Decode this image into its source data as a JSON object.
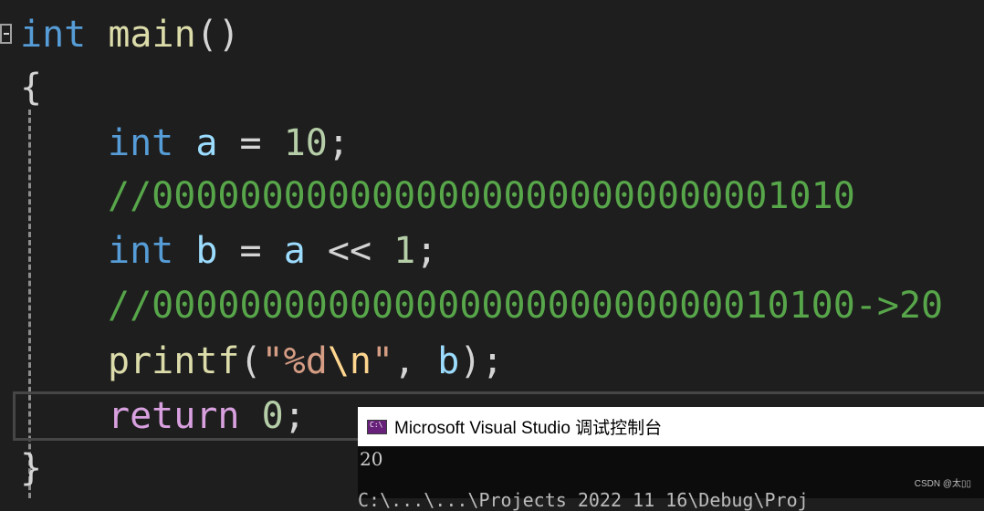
{
  "editor": {
    "lines": [
      {
        "tokens": [
          {
            "t": "int",
            "c": "kw"
          },
          {
            "t": " ",
            "c": "pun"
          },
          {
            "t": "main",
            "c": "fn"
          },
          {
            "t": "()",
            "c": "pun"
          }
        ]
      },
      {
        "tokens": [
          {
            "t": "{",
            "c": "pun"
          }
        ]
      },
      {
        "tokens": [
          {
            "t": "int",
            "c": "kw"
          },
          {
            "t": " ",
            "c": "pun"
          },
          {
            "t": "a",
            "c": "var"
          },
          {
            "t": " = ",
            "c": "pun"
          },
          {
            "t": "10",
            "c": "num"
          },
          {
            "t": ";",
            "c": "pun"
          }
        ]
      },
      {
        "tokens": [
          {
            "t": "//00000000000000000000000000001010",
            "c": "cmt"
          }
        ]
      },
      {
        "tokens": [
          {
            "t": "int",
            "c": "kw"
          },
          {
            "t": " ",
            "c": "pun"
          },
          {
            "t": "b",
            "c": "var"
          },
          {
            "t": " = ",
            "c": "pun"
          },
          {
            "t": "a",
            "c": "var"
          },
          {
            "t": " << ",
            "c": "pun"
          },
          {
            "t": "1",
            "c": "num"
          },
          {
            "t": ";",
            "c": "pun"
          }
        ]
      },
      {
        "tokens": [
          {
            "t": "//00000000000000000000000000010100->20",
            "c": "cmt"
          }
        ]
      },
      {
        "tokens": [
          {
            "t": "printf",
            "c": "fn"
          },
          {
            "t": "(",
            "c": "pun"
          },
          {
            "t": "\"%d",
            "c": "str"
          },
          {
            "t": "\\n",
            "c": "esc"
          },
          {
            "t": "\"",
            "c": "str"
          },
          {
            "t": ", ",
            "c": "pun"
          },
          {
            "t": "b",
            "c": "var"
          },
          {
            "t": ");",
            "c": "pun"
          }
        ]
      },
      {
        "tokens": [
          {
            "t": "return",
            "c": "ctl"
          },
          {
            "t": " ",
            "c": "pun"
          },
          {
            "t": "0",
            "c": "num"
          },
          {
            "t": ";",
            "c": "pun"
          }
        ]
      },
      {
        "tokens": [
          {
            "t": "}",
            "c": "pun"
          }
        ]
      }
    ]
  },
  "console": {
    "title": "Microsoft Visual Studio 调试控制台",
    "output": "20",
    "cut_line": "C:\\...\\...\\Projects 2022 11 16\\Debug\\Proj"
  },
  "watermark": "CSDN @太▯▯"
}
